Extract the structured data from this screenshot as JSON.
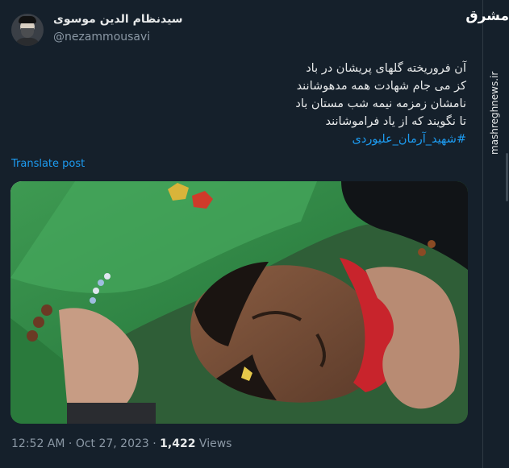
{
  "author": {
    "name": "سیدنظام الدین موسوی",
    "handle": "@nezammousavi"
  },
  "post": {
    "lines": [
      "آن فروریخته گلهای پریشان در باد",
      "کز می جام شهادت همه مدهوشانند",
      "نامشان زمزمه نیمه شب مستان باد",
      "تا نگویند که از یاد فراموشانند"
    ],
    "hashtag": "#شهید_آرمان_علیوردی",
    "translate_label": "Translate post"
  },
  "media": {
    "description_icon": "photo-icon"
  },
  "meta": {
    "time": "12:52 AM",
    "separator": "·",
    "date": "Oct 27, 2023",
    "views_count": "1,422",
    "views_label": "Views"
  },
  "watermark": {
    "logo": "مشرق",
    "site": "mashreghnews.ir"
  },
  "colors": {
    "background": "#15202b",
    "link": "#1d9bf0",
    "muted": "#8b98a5",
    "text": "#e7e9ea"
  }
}
